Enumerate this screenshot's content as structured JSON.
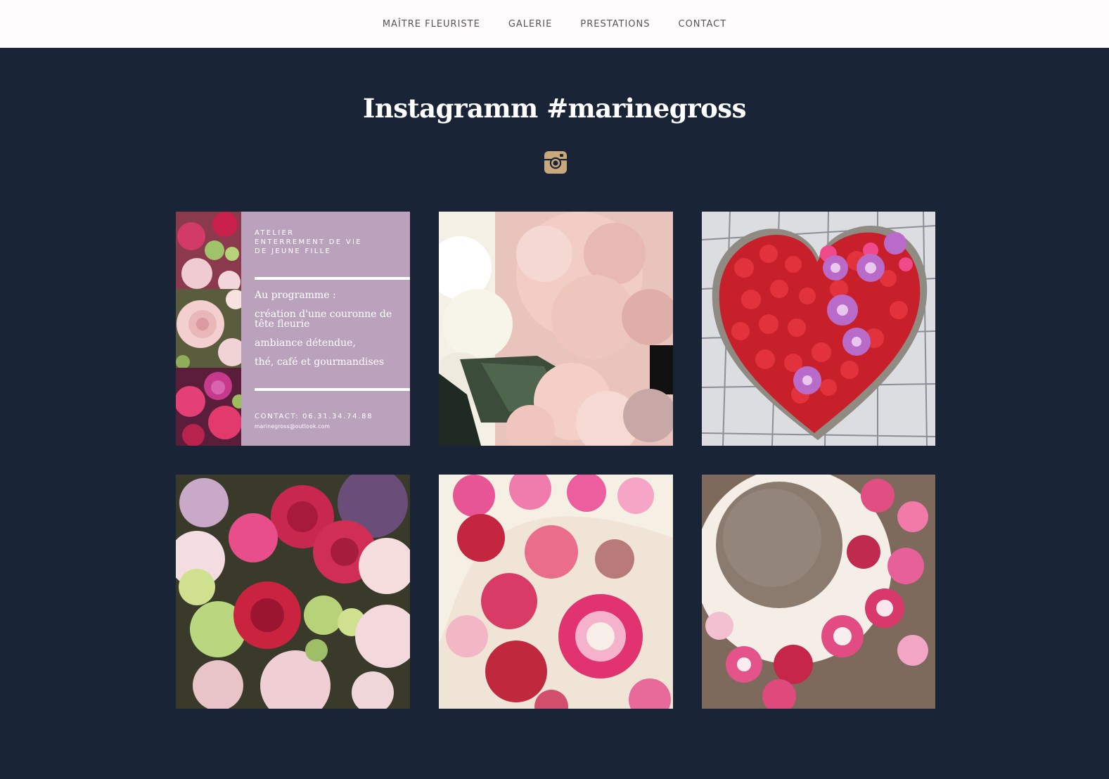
{
  "nav": {
    "items": [
      {
        "label": "MAÎTRE FLEURISTE"
      },
      {
        "label": "GALERIE"
      },
      {
        "label": "PRESTATIONS"
      },
      {
        "label": "CONTACT"
      }
    ]
  },
  "instagram": {
    "title": "Instagramm #marinegross",
    "icon": "instagram-icon",
    "icon_color": "#c8a97e"
  },
  "colors": {
    "page_background": "#1a2437",
    "nav_background": "#fefcfd",
    "card_background": "#bba2bc"
  },
  "gallery": {
    "card": {
      "heading": [
        "ATELIER",
        "ENTERREMENT DE VIE",
        "DE JEUNE FILLE"
      ],
      "program": [
        "Au programme :",
        "création d'une couronne de tête fleurie",
        "ambiance détendue,",
        "thé, café et gourmandises"
      ],
      "contact": "CONTACT: 06.31.34.74.88",
      "email": "marinegross@outlook.com"
    },
    "photos": [
      {
        "icon": "pink-hydrangea-photo"
      },
      {
        "icon": "red-rose-heart-arrangement-photo"
      },
      {
        "icon": "roses-bouquet-photo"
      },
      {
        "icon": "dried-flower-wreath-photo"
      },
      {
        "icon": "dried-flower-wreath-closeup-photo"
      }
    ]
  }
}
